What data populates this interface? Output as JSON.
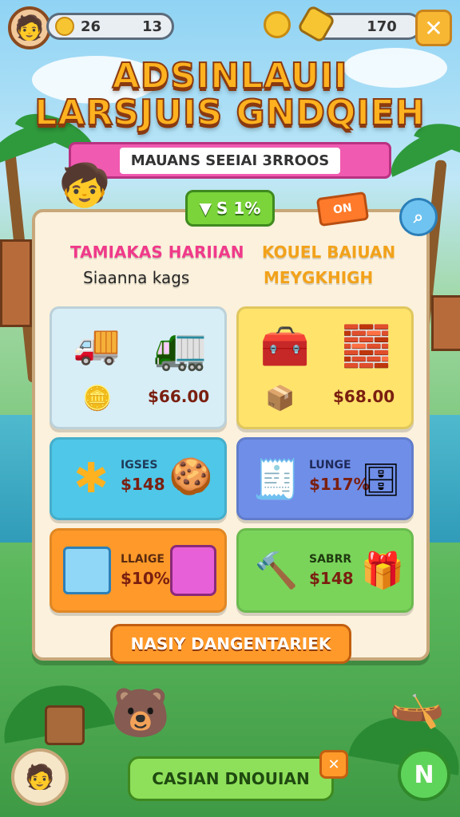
{
  "hud": {
    "coins_label": "26",
    "coins_count": "13",
    "gems_label": "170",
    "coin_glyph": "G"
  },
  "title": {
    "line1": "ADSINLAUII",
    "line2": "LARSJUIS GNDQIEH"
  },
  "banner": {
    "text": "MAUANS SEEIAI 3RROOS"
  },
  "tags": {
    "green_tag": "S 1%",
    "orange_tag": "ON"
  },
  "columns": {
    "left_title": "TAMIAKAS HARIIAN",
    "left_subtitle": "Siaanna kags",
    "right_title": "KOUEL BAIUAN",
    "right_subtitle": "MEYGKHIGH"
  },
  "cards": [
    {
      "price": "$66.00",
      "color": "#d7eef7"
    },
    {
      "price": "$68.00",
      "color": "#ffe36b"
    },
    {
      "label": "IGSES",
      "price": "$148",
      "color": "#4fc7e8"
    },
    {
      "label": "LUNGE",
      "price": "$117%",
      "color": "#6f8ee8"
    },
    {
      "label": "LLAIGE",
      "price": "$10%",
      "color": "#ff9a2a"
    },
    {
      "label": "SABRR",
      "price": "$148",
      "color": "#7ad45a"
    }
  ],
  "buttons": {
    "orange_button": "NASIY DANGENTARIEK",
    "green_button": "CASIAN DNOUIAN"
  },
  "icons": [
    "avatar-icon",
    "coin-icon",
    "gem-icon",
    "close-icon",
    "search-icon",
    "cart-icon",
    "truck-icon",
    "gift-icon",
    "x-icon"
  ]
}
